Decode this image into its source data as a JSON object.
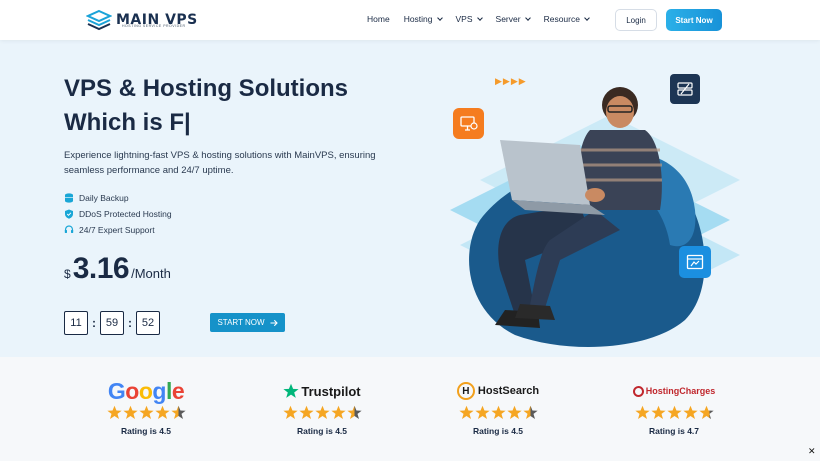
{
  "nav": {
    "logo_text": "MAIN VPS",
    "logo_tagline": "HOSTING SERVICE PROVIDER",
    "menu": [
      {
        "label": "Home",
        "dropdown": false
      },
      {
        "label": "Hosting",
        "dropdown": true
      },
      {
        "label": "VPS",
        "dropdown": true
      },
      {
        "label": "Server",
        "dropdown": true
      },
      {
        "label": "Resource",
        "dropdown": true
      }
    ],
    "login_label": "Login",
    "start_label": "Start Now"
  },
  "hero": {
    "title_line1": "VPS & Hosting Solutions",
    "title_line2": "Which is F|",
    "description": "Experience lightning-fast VPS & hosting solutions with MainVPS, ensuring seamless performance and 24/7 uptime.",
    "features": [
      "Daily Backup",
      "DDoS Protected Hosting",
      "24/7 Expert Support"
    ],
    "price": {
      "currency": "$",
      "amount": "3.16",
      "period": "/Month"
    },
    "timer": [
      "11",
      "59",
      "52"
    ],
    "cta_label": "START NOW",
    "arrows": "▶▶▶▶"
  },
  "ratings": [
    {
      "brand": "Google",
      "text": "Rating is 4.5",
      "stars": 4.5
    },
    {
      "brand": "Trustpilot",
      "text": "Rating is 4.5",
      "stars": 4.5
    },
    {
      "brand": "HostSearch",
      "text": "Rating is 4.5",
      "stars": 4.5
    },
    {
      "brand": "HostingCharges",
      "text": "Rating is 4.7",
      "stars": 4.7
    }
  ],
  "colors": {
    "accent": "#1592c9",
    "star": "#f5a623",
    "brand_dark": "#1a2a44"
  }
}
